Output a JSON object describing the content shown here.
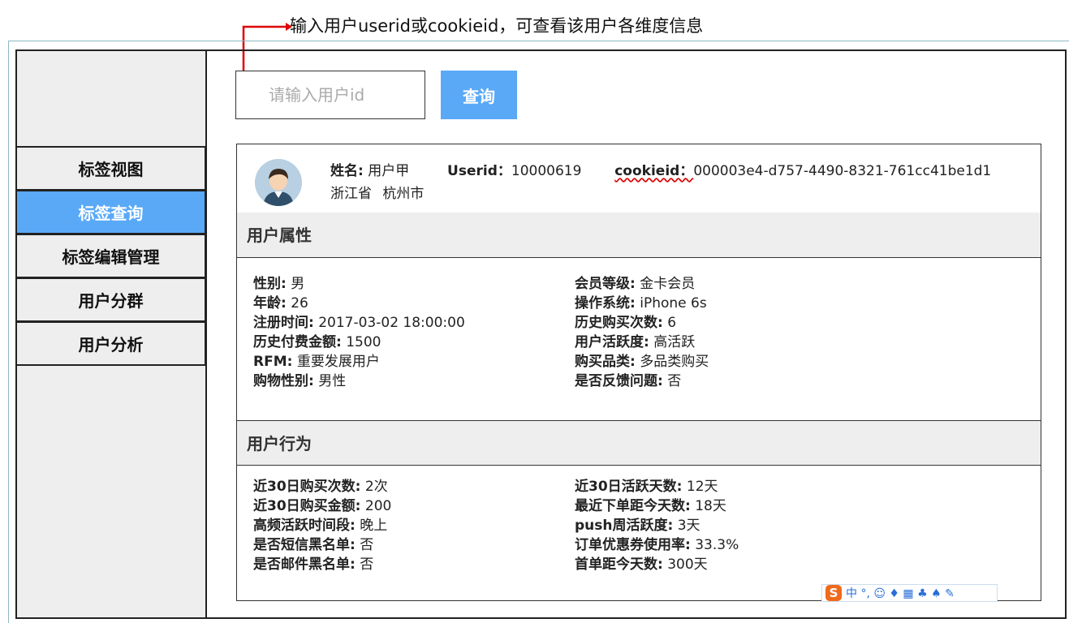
{
  "annotation": "输入用户userid或cookieid，可查看该用户各维度信息",
  "sidebar": {
    "items": [
      {
        "label": "标签视图",
        "active": false
      },
      {
        "label": "标签查询",
        "active": true
      },
      {
        "label": "标签编辑管理",
        "active": false
      },
      {
        "label": "用户分群",
        "active": false
      },
      {
        "label": "用户分析",
        "active": false
      }
    ]
  },
  "search": {
    "placeholder": "请输入用户id",
    "button": "查询"
  },
  "profile": {
    "name_label": "姓名:",
    "name_value": "用户甲",
    "userid_label": "Userid：",
    "userid_value": "10000619",
    "cookie_label": "cookieid：",
    "cookie_value": "000003e4-d757-4490-8321-761cc41be1d1",
    "province": "浙江省",
    "city": "杭州市"
  },
  "attributes": {
    "title": "用户属性",
    "left": [
      {
        "label": "性别:",
        "value": "男"
      },
      {
        "label": "年龄:",
        "value": "26"
      },
      {
        "label": "注册时间:",
        "value": "2017-03-02 18:00:00"
      },
      {
        "label": "历史付费金额:",
        "value": "1500"
      },
      {
        "label": "RFM:",
        "value": "重要发展用户"
      },
      {
        "label": "购物性别:",
        "value": "男性"
      }
    ],
    "right": [
      {
        "label": "会员等级:",
        "value": "金卡会员"
      },
      {
        "label": "操作系统:",
        "value": "iPhone 6s"
      },
      {
        "label": "历史购买次数:",
        "value": "6"
      },
      {
        "label": "用户活跃度:",
        "value": "高活跃"
      },
      {
        "label": "购买品类:",
        "value": "多品类购买"
      },
      {
        "label": "是否反馈问题:",
        "value": "否"
      }
    ]
  },
  "behavior": {
    "title": "用户行为",
    "left": [
      {
        "label": "近30日购买次数:",
        "value": "2次"
      },
      {
        "label": "近30日购买金额:",
        "value": "200"
      },
      {
        "label": "高频活跃时间段:",
        "value": "晚上"
      },
      {
        "label": "是否短信黑名单:",
        "value": "否"
      },
      {
        "label": "是否邮件黑名单:",
        "value": "否"
      }
    ],
    "right": [
      {
        "label": "近30日活跃天数:",
        "value": "12天"
      },
      {
        "label": "最近下单距今天数:",
        "value": "18天"
      },
      {
        "label": "push周活跃度:",
        "value": "3天"
      },
      {
        "label": "订单优惠券使用率:",
        "value": "33.3%"
      },
      {
        "label": "首单距今天数:",
        "value": "300天"
      }
    ]
  },
  "ime": {
    "logo": "S",
    "text": "中 °, ☺ ♦ ▦ ♣ ♠ ✎"
  }
}
